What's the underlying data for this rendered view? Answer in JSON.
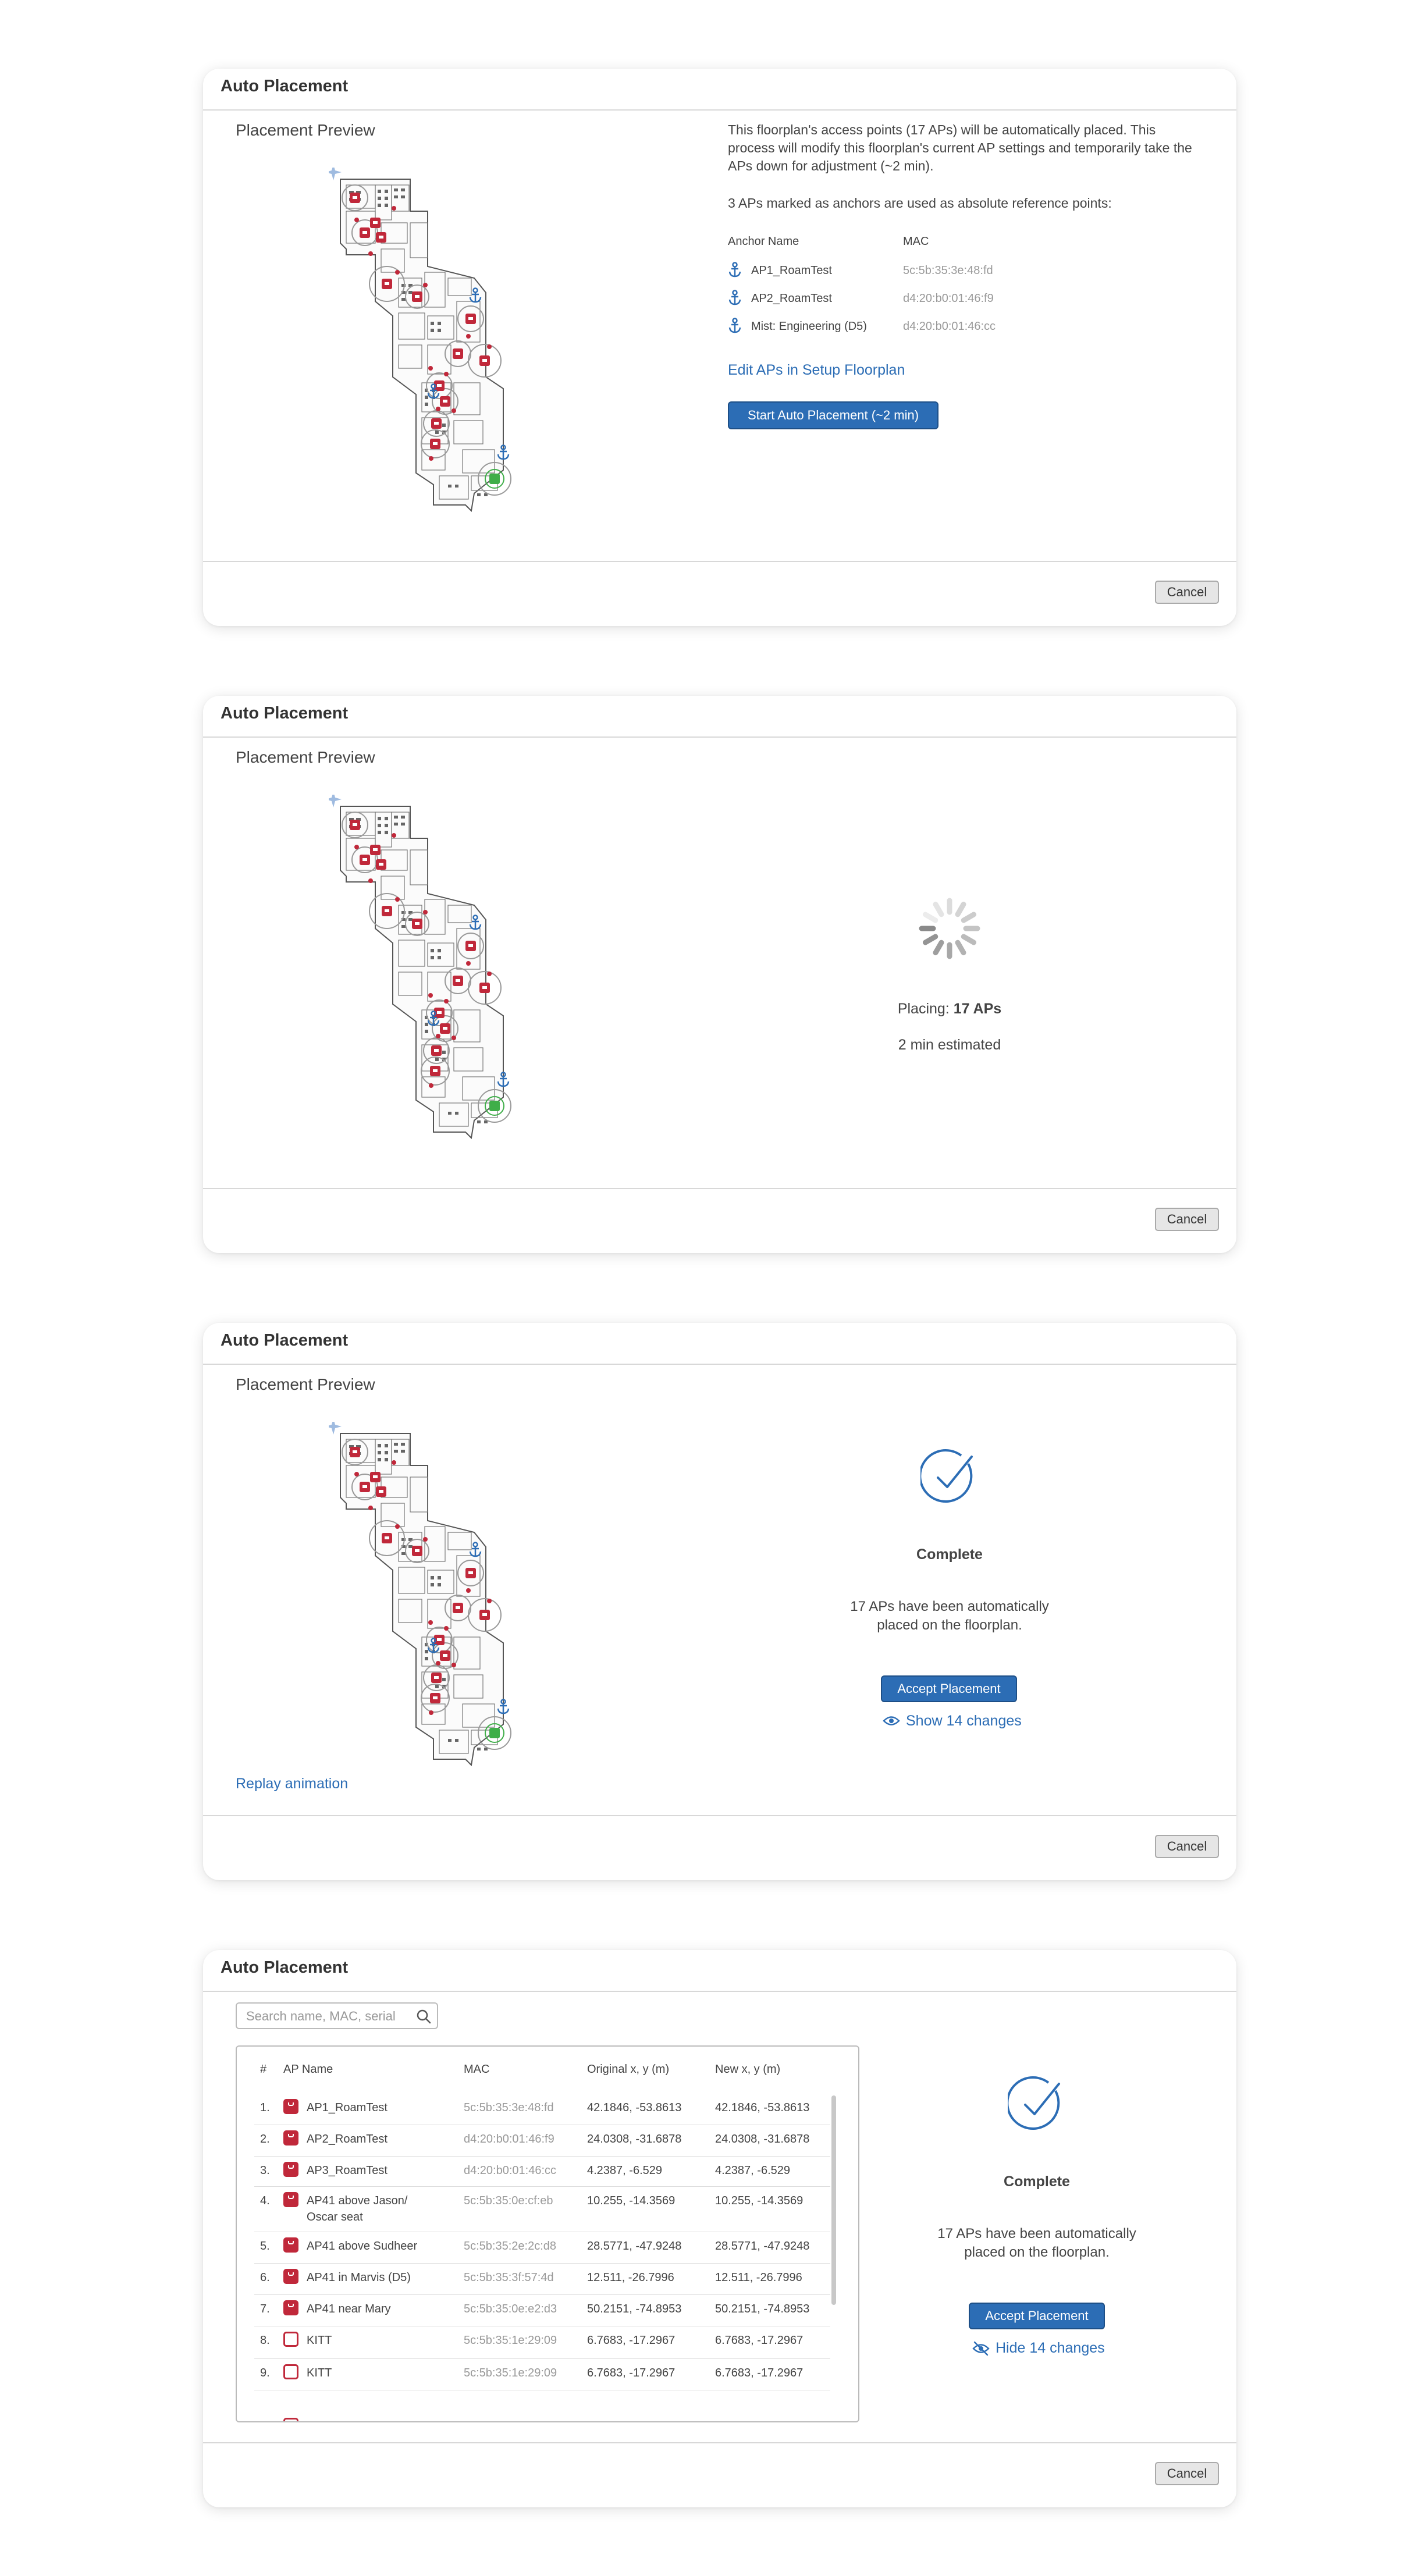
{
  "title": "Auto Placement",
  "cancel_label": "Cancel",
  "placement_preview_label": "Placement Preview",
  "panel1": {
    "description": "This floorplan's access points (17 APs) will be automatically placed. This process will modify this floorplan's current AP settings and temporarily take the APs down for adjustment (~2 min).",
    "anchors_intro": "3 APs marked as anchors are used as absolute reference points:",
    "col_anchor_name": "Anchor Name",
    "col_mac": "MAC",
    "anchors": [
      {
        "name": "AP1_RoamTest",
        "mac": "5c:5b:35:3e:48:fd"
      },
      {
        "name": "AP2_RoamTest",
        "mac": "d4:20:b0:01:46:f9"
      },
      {
        "name": "Mist: Engineering (D5)",
        "mac": "d4:20:b0:01:46:cc"
      }
    ],
    "edit_link": "Edit APs in Setup Floorplan",
    "start_button": "Start Auto Placement (~2 min)"
  },
  "panel2": {
    "placing_prefix": "Placing: ",
    "placing_count": "17 APs",
    "estimate": "2 min estimated"
  },
  "panel3": {
    "complete": "Complete",
    "message": "17 APs have been automatically placed on the floorplan.",
    "accept_button": "Accept Placement",
    "show_changes": "Show 14 changes",
    "replay": "Replay animation"
  },
  "panel4": {
    "search_placeholder": "Search name, MAC, serial",
    "headers": {
      "num": "#",
      "name": "AP Name",
      "mac": "MAC",
      "orig": "Original x, y (m)",
      "new": "New x, y (m)"
    },
    "rows": [
      {
        "num": "1.",
        "name": "AP1_RoamTest",
        "mac": "5c:5b:35:3e:48:fd",
        "orig": "42.1846, -53.8613",
        "new": "42.1846, -53.8613",
        "icon": "filled"
      },
      {
        "num": "2.",
        "name": "AP2_RoamTest",
        "mac": "d4:20:b0:01:46:f9",
        "orig": "24.0308, -31.6878",
        "new": "24.0308, -31.6878",
        "icon": "filled"
      },
      {
        "num": "3.",
        "name": "AP3_RoamTest",
        "mac": "d4:20:b0:01:46:cc",
        "orig": "4.2387, -6.529",
        "new": "4.2387, -6.529",
        "icon": "filled"
      },
      {
        "num": "4.",
        "name": "AP41 above Jason/",
        "name2": "Oscar seat",
        "mac": "5c:5b:35:0e:cf:eb",
        "orig": "10.255, -14.3569",
        "new": "10.255, -14.3569",
        "icon": "filled"
      },
      {
        "num": "5.",
        "name": "AP41 above Sudheer",
        "mac": "5c:5b:35:2e:2c:d8",
        "orig": "28.5771, -47.9248",
        "new": "28.5771, -47.9248",
        "icon": "filled"
      },
      {
        "num": "6.",
        "name": "AP41 in Marvis (D5)",
        "mac": "5c:5b:35:3f:57:4d",
        "orig": "12.511, -26.7996",
        "new": "12.511, -26.7996",
        "icon": "filled"
      },
      {
        "num": "7.",
        "name": "AP41 near Mary",
        "mac": "5c:5b:35:0e:e2:d3",
        "orig": "50.2151, -74.8953",
        "new": "50.2151, -74.8953",
        "icon": "filled"
      },
      {
        "num": "8.",
        "name": "KITT",
        "mac": "5c:5b:35:1e:29:09",
        "orig": "6.7683, -17.2967",
        "new": "6.7683, -17.2967",
        "icon": "outline"
      },
      {
        "num": "9.",
        "name": "KITT",
        "mac": "5c:5b:35:1e:29:09",
        "orig": "6.7683, -17.2967",
        "new": "6.7683, -17.2967",
        "icon": "outline"
      }
    ],
    "complete": "Complete",
    "message": "17 APs have been automatically placed on the floorplan.",
    "accept_button": "Accept Placement",
    "hide_changes": "Hide 14 changes"
  },
  "colors": {
    "accent": "#2c6db5",
    "ap_red": "#c0283a",
    "anchor_blue": "#2c6db5",
    "ap_green": "#3fae49"
  }
}
